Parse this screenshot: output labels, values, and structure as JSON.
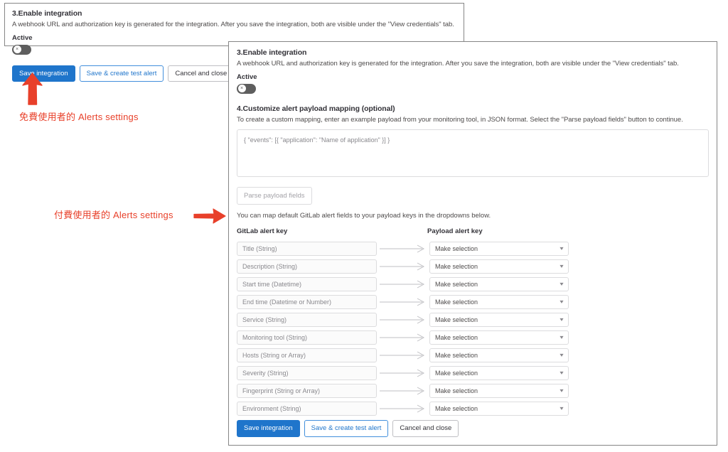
{
  "free_panel": {
    "step_heading": "3.Enable integration",
    "step_desc": "A webhook URL and authorization key is generated for the integration. After you save the integration, both are visible under the \"View credentials\" tab.",
    "active_label": "Active",
    "toggle_state": "off",
    "toggle_glyph": "×",
    "buttons": {
      "save": "Save integration",
      "save_test": "Save & create test alert",
      "cancel": "Cancel and close"
    }
  },
  "paid_panel": {
    "step3_heading": "3.Enable integration",
    "step3_desc": "A webhook URL and authorization key is generated for the integration. After you save the integration, both are visible under the \"View credentials\" tab.",
    "active_label": "Active",
    "toggle_state": "off",
    "toggle_glyph": "×",
    "step4_heading": "4.Customize alert payload mapping (optional)",
    "step4_desc": "To create a custom mapping, enter an example payload from your monitoring tool, in JSON format. Select the \"Parse payload fields\" button to continue.",
    "payload_placeholder": "{ \"events\": [{ \"application\": \"Name of application\" }] }",
    "payload_value": "",
    "parse_button": "Parse payload fields",
    "mapping_helper": "You can map default GitLab alert fields to your payload keys in the dropdowns below.",
    "col_left_header": "GitLab alert key",
    "col_right_header": "Payload alert key",
    "select_placeholder": "Make selection",
    "mappings": [
      {
        "gitlab_key": "Title (String)",
        "payload_key": "Make selection"
      },
      {
        "gitlab_key": "Description (String)",
        "payload_key": "Make selection"
      },
      {
        "gitlab_key": "Start time (Datetime)",
        "payload_key": "Make selection"
      },
      {
        "gitlab_key": "End time (Datetime or Number)",
        "payload_key": "Make selection"
      },
      {
        "gitlab_key": "Service (String)",
        "payload_key": "Make selection"
      },
      {
        "gitlab_key": "Monitoring tool (String)",
        "payload_key": "Make selection"
      },
      {
        "gitlab_key": "Hosts (String or Array)",
        "payload_key": "Make selection"
      },
      {
        "gitlab_key": "Severity (String)",
        "payload_key": "Make selection"
      },
      {
        "gitlab_key": "Fingerprint (String or Array)",
        "payload_key": "Make selection"
      },
      {
        "gitlab_key": "Environment (String)",
        "payload_key": "Make selection"
      }
    ],
    "buttons": {
      "save": "Save integration",
      "save_test": "Save & create test alert",
      "cancel": "Cancel and close"
    }
  },
  "annotations": {
    "free_label": "免費使用者的 Alerts settings",
    "paid_label": "付費使用者的 Alerts settings",
    "color": "#e8402a"
  },
  "colors": {
    "primary_blue": "#1f75cb",
    "confirm_border": "#428fdc",
    "panel_border": "#868686",
    "input_border": "#dcdcde",
    "toggle_off": "#5e5e5e",
    "annotation_red": "#e8402a"
  }
}
